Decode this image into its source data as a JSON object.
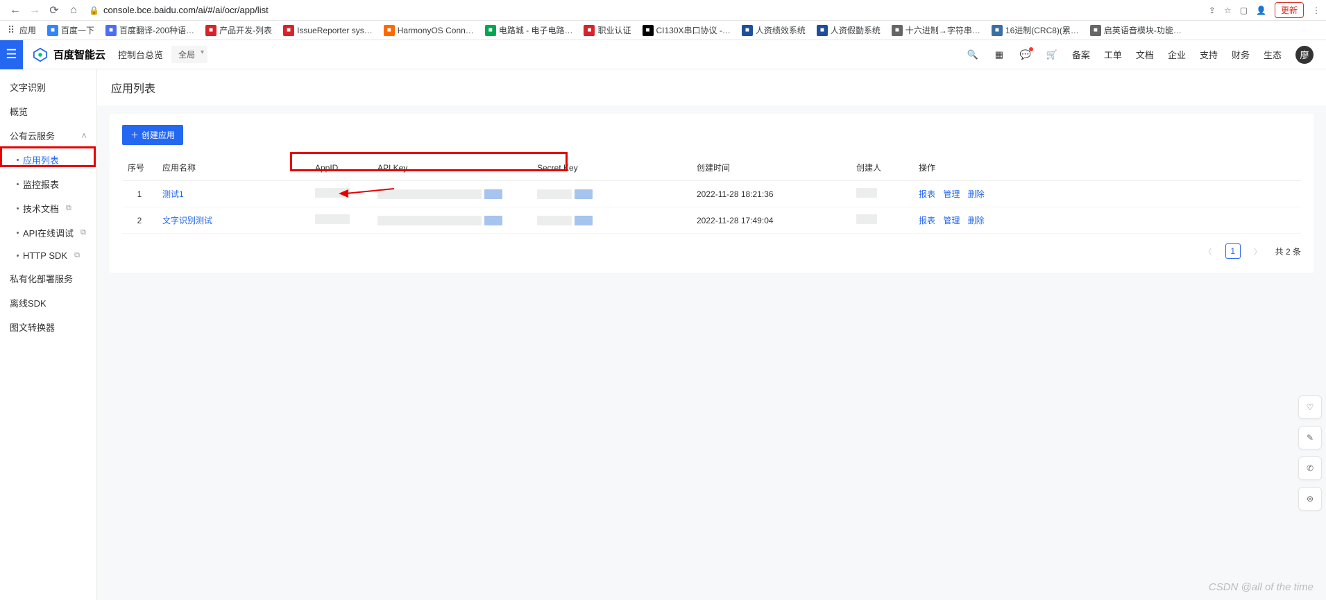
{
  "browser": {
    "url": "console.bce.baidu.com/ai/#/ai/ocr/app/list",
    "update_label": "更新",
    "bookmarks": [
      {
        "label": "应用",
        "color": "#e8453c"
      },
      {
        "label": "百度一下",
        "color": "#3385ff"
      },
      {
        "label": "百度翻译-200种语…",
        "color": "#4e6ef2"
      },
      {
        "label": "产品开发-列表",
        "color": "#d8232a"
      },
      {
        "label": "IssueReporter sys…",
        "color": "#d8232a"
      },
      {
        "label": "HarmonyOS Conn…",
        "color": "#ff6a00"
      },
      {
        "label": "电路城 - 电子电路…",
        "color": "#00a651"
      },
      {
        "label": "职业认证",
        "color": "#d8232a"
      },
      {
        "label": "CI130X串口协议 -…",
        "color": "#000"
      },
      {
        "label": "人资绩效系统",
        "color": "#1e4f9c"
      },
      {
        "label": "人资假勤系统",
        "color": "#1e4f9c"
      },
      {
        "label": "十六进制→字符串…",
        "color": "#666"
      },
      {
        "label": "16进制(CRC8)(累…",
        "color": "#3b6ea5"
      },
      {
        "label": "启英语音模块-功能…",
        "color": "#666"
      }
    ]
  },
  "header": {
    "brand": "百度智能云",
    "scope_label": "控制台总览",
    "scope_selected": "全局",
    "nav": [
      "备案",
      "工单",
      "文档",
      "企业",
      "支持",
      "财务",
      "生态"
    ],
    "avatar_text": "廖"
  },
  "sidebar": {
    "title": "文字识别",
    "overview": "概览",
    "cloud_group": "公有云服务",
    "items": [
      {
        "label": "应用列表",
        "active": true
      },
      {
        "label": "监控报表"
      },
      {
        "label": "技术文档",
        "ext": true
      },
      {
        "label": "API在线调试",
        "ext": true
      },
      {
        "label": "HTTP SDK",
        "ext": true
      }
    ],
    "private": "私有化部署服务",
    "offline": "离线SDK",
    "converter": "图文转换器"
  },
  "page": {
    "title": "应用列表",
    "create_btn": "创建应用",
    "columns": {
      "seq": "序号",
      "name": "应用名称",
      "appid": "AppID",
      "apikey": "API Key",
      "secret": "Secret Key",
      "created": "创建时间",
      "creator": "创建人",
      "ops": "操作"
    },
    "rows": [
      {
        "seq": "1",
        "name": "测试1",
        "created": "2022-11-28 18:21:36"
      },
      {
        "seq": "2",
        "name": "文字识别测试",
        "created": "2022-11-28 17:49:04"
      }
    ],
    "actions": {
      "report": "报表",
      "manage": "管理",
      "delete": "删除"
    },
    "pager": {
      "current": "1",
      "total": "共 2 条"
    }
  },
  "watermark": "CSDN @all of the time"
}
